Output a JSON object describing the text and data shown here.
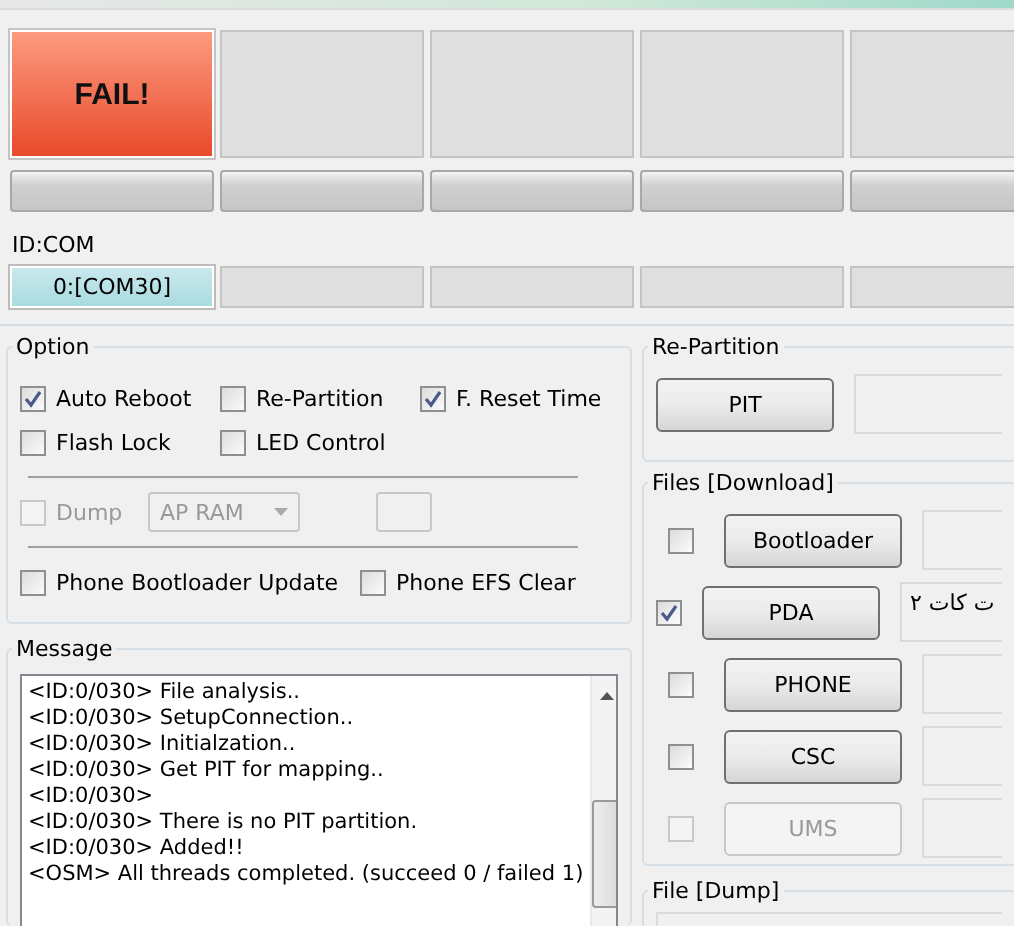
{
  "slots": [
    {
      "kind": "fail",
      "label": "FAIL!"
    },
    {
      "kind": "idle"
    },
    {
      "kind": "idle"
    },
    {
      "kind": "idle"
    },
    {
      "kind": "idle"
    }
  ],
  "progress": [
    {
      "level": 0
    },
    {
      "level": 0
    },
    {
      "level": 0
    },
    {
      "level": 0
    },
    {
      "level": 0
    }
  ],
  "id_com": {
    "title": "ID:COM",
    "ports": [
      {
        "label": "0:[COM30]",
        "selected": true
      },
      {
        "selected": false
      },
      {
        "selected": false
      },
      {
        "selected": false
      },
      {
        "selected": false
      }
    ]
  },
  "option": {
    "title": "Option",
    "row_1": [
      {
        "label": "Auto Reboot",
        "checked": true
      },
      {
        "label": "Re-Partition",
        "checked": false
      },
      {
        "label": "F. Reset Time",
        "checked": true
      }
    ],
    "row_2": [
      {
        "label": "Flash Lock",
        "checked": false
      },
      {
        "label": "LED Control",
        "checked": false
      }
    ],
    "dump": {
      "label": "Dump",
      "checked": false,
      "disabled": true,
      "select": "AP RAM"
    },
    "row_3": [
      {
        "label": "Phone Bootloader Update",
        "checked": false
      },
      {
        "label": "Phone EFS Clear",
        "checked": false
      }
    ]
  },
  "message": {
    "title": "Message",
    "lines": [
      "<ID:0/030> File analysis..",
      "<ID:0/030> SetupConnection..",
      "<ID:0/030> Initialzation..",
      "<ID:0/030> Get PIT for mapping..",
      "<ID:0/030>",
      "<ID:0/030> There is no PIT partition.",
      "<ID:0/030> Added!!",
      "<OSM> All threads completed. (succeed 0 / failed 1)"
    ]
  },
  "repartition": {
    "title": "Re-Partition",
    "button": "PIT"
  },
  "files": {
    "title": "Files [Download]",
    "rows": [
      {
        "label": "Bootloader",
        "checked": false,
        "disabled": false
      },
      {
        "label": "PDA",
        "checked": true,
        "disabled": false,
        "value": "ت کات ۲"
      },
      {
        "label": "PHONE",
        "checked": false,
        "disabled": false
      },
      {
        "label": "CSC",
        "checked": false,
        "disabled": false
      },
      {
        "label": "UMS",
        "checked": false,
        "disabled": true
      }
    ]
  },
  "file_dump": {
    "title": "File [Dump]"
  }
}
